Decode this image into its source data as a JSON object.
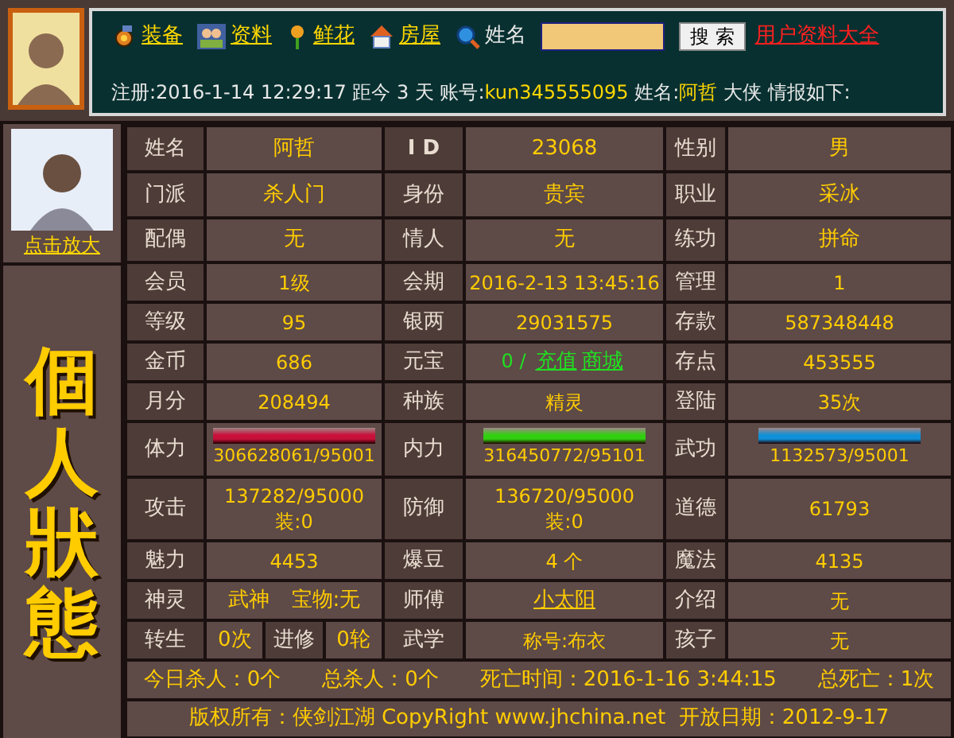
{
  "header": {
    "links": [
      {
        "label": "装备",
        "kind": "gear"
      },
      {
        "label": "资料",
        "kind": "people"
      },
      {
        "label": "鲜花",
        "kind": "flower"
      },
      {
        "label": "房屋",
        "kind": "house"
      }
    ],
    "search": {
      "label": "姓名",
      "button": "搜 索"
    },
    "all_link": "用户资料大全",
    "info": [
      {
        "text": "注册:2016-1-14 12:29:17 距今 3 天 账号:",
        "highlight": false
      },
      {
        "text": "kun345555095",
        "highlight": true
      },
      {
        "text": " 姓名:",
        "highlight": false
      },
      {
        "text": "阿哲",
        "highlight": true
      },
      {
        "text": " 大侠 情报如下:",
        "highlight": false
      }
    ]
  },
  "sidebar": {
    "zoom_link": "点击放大",
    "title": "個人狀態"
  },
  "rows": [
    [
      {
        "kind": "label",
        "text": "姓名"
      },
      {
        "kind": "value",
        "text": "阿哲"
      },
      {
        "kind": "label",
        "text": "I D",
        "bold": true
      },
      {
        "kind": "value",
        "text": "23068"
      },
      {
        "kind": "label",
        "text": "性别"
      },
      {
        "kind": "value",
        "text": "男"
      }
    ],
    [
      {
        "kind": "label",
        "text": "门派"
      },
      {
        "kind": "value",
        "text": "杀人门"
      },
      {
        "kind": "label",
        "text": "身份"
      },
      {
        "kind": "value",
        "text": "贵宾"
      },
      {
        "kind": "label",
        "text": "职业"
      },
      {
        "kind": "value",
        "text": "采冰"
      }
    ],
    [
      {
        "kind": "label",
        "text": "配偶"
      },
      {
        "kind": "value",
        "text": "无"
      },
      {
        "kind": "label",
        "text": "情人"
      },
      {
        "kind": "value",
        "text": "无"
      },
      {
        "kind": "label",
        "text": "练功"
      },
      {
        "kind": "value",
        "text": "拼命"
      }
    ],
    [
      {
        "kind": "label",
        "text": "会员"
      },
      {
        "kind": "value",
        "text": "1级"
      },
      {
        "kind": "label",
        "text": "会期"
      },
      {
        "kind": "value",
        "text": "2016-2-13 13:45:16"
      },
      {
        "kind": "label",
        "text": "管理"
      },
      {
        "kind": "value",
        "text": "1"
      }
    ],
    [
      {
        "kind": "label",
        "text": "等级"
      },
      {
        "kind": "value",
        "text": "95"
      },
      {
        "kind": "label",
        "text": "银两"
      },
      {
        "kind": "value",
        "text": "29031575"
      },
      {
        "kind": "label",
        "text": "存款"
      },
      {
        "kind": "value",
        "text": "587348448"
      }
    ],
    [
      {
        "kind": "label",
        "text": "金币"
      },
      {
        "kind": "value",
        "text": "686"
      },
      {
        "kind": "label",
        "text": "元宝"
      },
      {
        "kind": "money",
        "text": "0 /",
        "links": [
          "充值",
          "商城"
        ]
      },
      {
        "kind": "label",
        "text": "存点"
      },
      {
        "kind": "value",
        "text": "453555"
      }
    ],
    [
      {
        "kind": "label",
        "text": "月分"
      },
      {
        "kind": "value",
        "text": "208494"
      },
      {
        "kind": "label",
        "text": "种族"
      },
      {
        "kind": "value",
        "text": "精灵"
      },
      {
        "kind": "label",
        "text": "登陆"
      },
      {
        "kind": "value",
        "text": "35次"
      }
    ],
    [
      {
        "kind": "label",
        "text": "体力"
      },
      {
        "kind": "bar",
        "color": "#c8103a",
        "level": 1,
        "text": "306628061/95001"
      },
      {
        "kind": "label",
        "text": "内力"
      },
      {
        "kind": "bar",
        "color": "#30d010",
        "level": 1,
        "text": "316450772/95101"
      },
      {
        "kind": "label",
        "text": "武功"
      },
      {
        "kind": "bar",
        "color": "#1090d8",
        "level": 1,
        "text": "1132573/95001"
      }
    ],
    [
      {
        "kind": "label",
        "text": "攻击"
      },
      {
        "kind": "multi",
        "lines": [
          "137282/95000",
          "装:0"
        ]
      },
      {
        "kind": "label",
        "text": "防御"
      },
      {
        "kind": "multi",
        "lines": [
          "136720/95000",
          "装:0"
        ]
      },
      {
        "kind": "label",
        "text": "道德"
      },
      {
        "kind": "value",
        "text": "61793"
      }
    ],
    [
      {
        "kind": "label",
        "text": "魅力"
      },
      {
        "kind": "value",
        "text": "4453"
      },
      {
        "kind": "label",
        "text": "爆豆"
      },
      {
        "kind": "value",
        "text": "4 个"
      },
      {
        "kind": "label",
        "text": "魔法"
      },
      {
        "kind": "value",
        "text": "4135"
      }
    ],
    [
      {
        "kind": "label",
        "text": "神灵"
      },
      {
        "kind": "pair",
        "texts": [
          "武神",
          "宝物:无"
        ]
      },
      {
        "kind": "label",
        "text": "师傅"
      },
      {
        "kind": "link",
        "text": "小太阳"
      },
      {
        "kind": "label",
        "text": "介绍"
      },
      {
        "kind": "value",
        "text": "无"
      }
    ],
    [
      {
        "kind": "label",
        "text": "转生"
      },
      {
        "kind": "split",
        "parts": [
          {
            "kind": "value",
            "text": "0次"
          },
          {
            "kind": "label",
            "text": "进修"
          },
          {
            "kind": "value",
            "text": "0轮"
          }
        ]
      },
      {
        "kind": "label",
        "text": "武学"
      },
      {
        "kind": "value",
        "text": "称号:布衣"
      },
      {
        "kind": "label",
        "text": "孩子"
      },
      {
        "kind": "value",
        "text": "无"
      }
    ]
  ],
  "summary": [
    "今日杀人：0个",
    "总杀人：0个",
    "死亡时间：2016-1-16 3:44:15",
    "总死亡：1次"
  ],
  "footer": "版权所有：侠剑江湖 CopyRight www.jhchina.net  开放日期：2012-9-17"
}
